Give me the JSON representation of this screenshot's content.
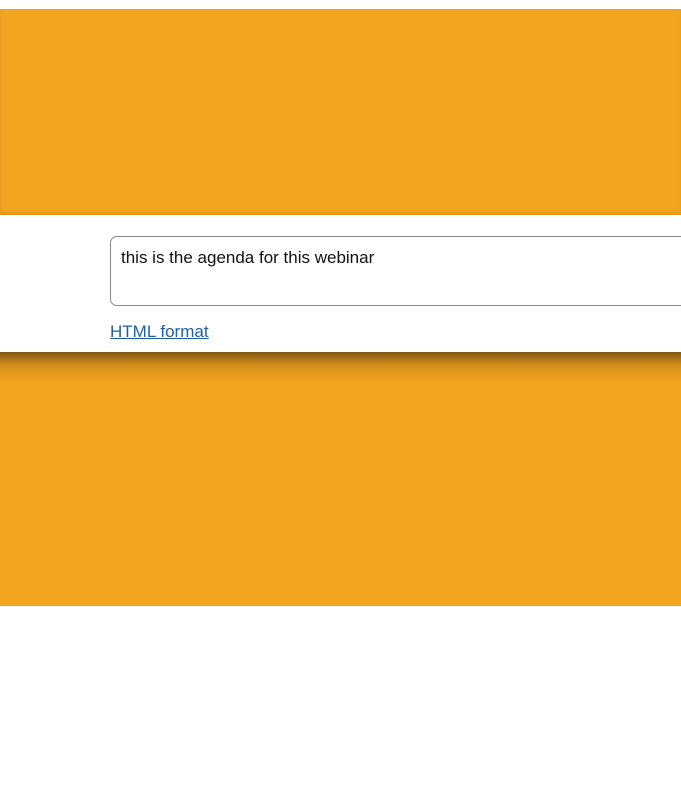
{
  "agenda": {
    "text": "this is the agenda for this webinar"
  },
  "format_link": {
    "label": "HTML format"
  },
  "colors": {
    "accent_orange": "#f2a51f",
    "link_blue": "#1f5fa6"
  }
}
